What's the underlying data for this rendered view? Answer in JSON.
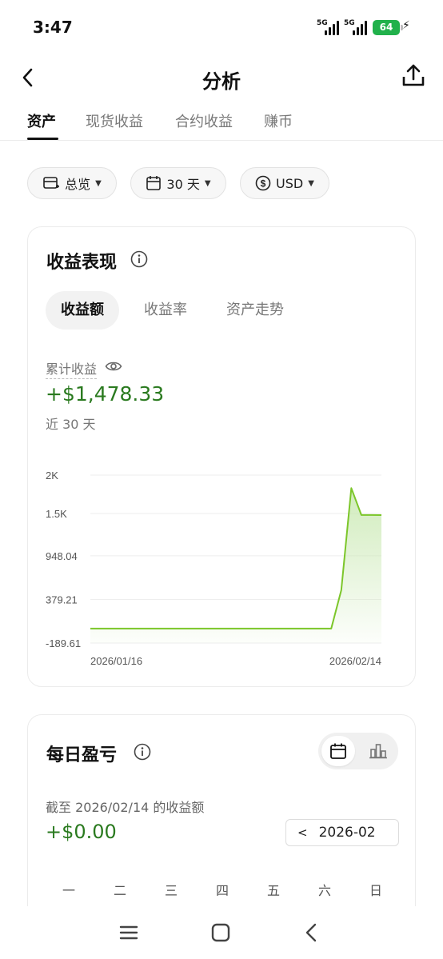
{
  "status": {
    "time": "3:47",
    "sim1": "5G",
    "sim2": "5G",
    "battery": "64"
  },
  "header": {
    "title": "分析"
  },
  "tabs": [
    {
      "label": "资产",
      "active": true
    },
    {
      "label": "现货收益",
      "active": false
    },
    {
      "label": "合约收益",
      "active": false
    },
    {
      "label": "赚币",
      "active": false
    }
  ],
  "filters": {
    "scope": "总览",
    "range": "30 天",
    "currency": "USD"
  },
  "performance": {
    "title": "收益表现",
    "segments": [
      {
        "label": "收益额",
        "active": true
      },
      {
        "label": "收益率",
        "active": false
      },
      {
        "label": "资产走势",
        "active": false
      }
    ],
    "cumulative_label": "累计收益",
    "cumulative_value": "+$1,478.33",
    "period_label": "近 30 天"
  },
  "chart_data": {
    "type": "area",
    "y_tick_labels": [
      "2K",
      "1.5K",
      "948.04",
      "379.21",
      "-189.61"
    ],
    "y_ticks": [
      2000,
      1500,
      948.04,
      379.21,
      -189.61
    ],
    "ylim": [
      -189.61,
      2000
    ],
    "x_tick_labels": [
      "2026/01/16",
      "2026/02/14"
    ],
    "x": [
      "2026/01/16",
      "2026/01/17",
      "2026/01/18",
      "2026/01/19",
      "2026/01/20",
      "2026/01/21",
      "2026/01/22",
      "2026/01/23",
      "2026/01/24",
      "2026/01/25",
      "2026/01/26",
      "2026/01/27",
      "2026/01/28",
      "2026/01/29",
      "2026/01/30",
      "2026/01/31",
      "2026/02/01",
      "2026/02/02",
      "2026/02/03",
      "2026/02/04",
      "2026/02/05",
      "2026/02/06",
      "2026/02/07",
      "2026/02/08",
      "2026/02/09",
      "2026/02/10",
      "2026/02/11",
      "2026/02/12",
      "2026/02/13",
      "2026/02/14"
    ],
    "values": [
      0,
      0,
      0,
      0,
      0,
      0,
      0,
      0,
      0,
      0,
      0,
      0,
      0,
      0,
      0,
      0,
      0,
      0,
      0,
      0,
      0,
      0,
      0,
      0,
      0,
      500,
      1830,
      1480,
      1480,
      1478.33
    ],
    "line_color": "#7cc62a",
    "fill_color": "#c8e8b0",
    "grid": true
  },
  "daily": {
    "title": "每日盈亏",
    "as_of": "截至 2026/02/14 的收益额",
    "value": "+$0.00",
    "month": "2026-02",
    "weekdays": [
      "一",
      "二",
      "三",
      "四",
      "五",
      "六",
      "日"
    ]
  },
  "colors": {
    "positive": "#2a7a1f",
    "accent": "#7cc62a"
  }
}
